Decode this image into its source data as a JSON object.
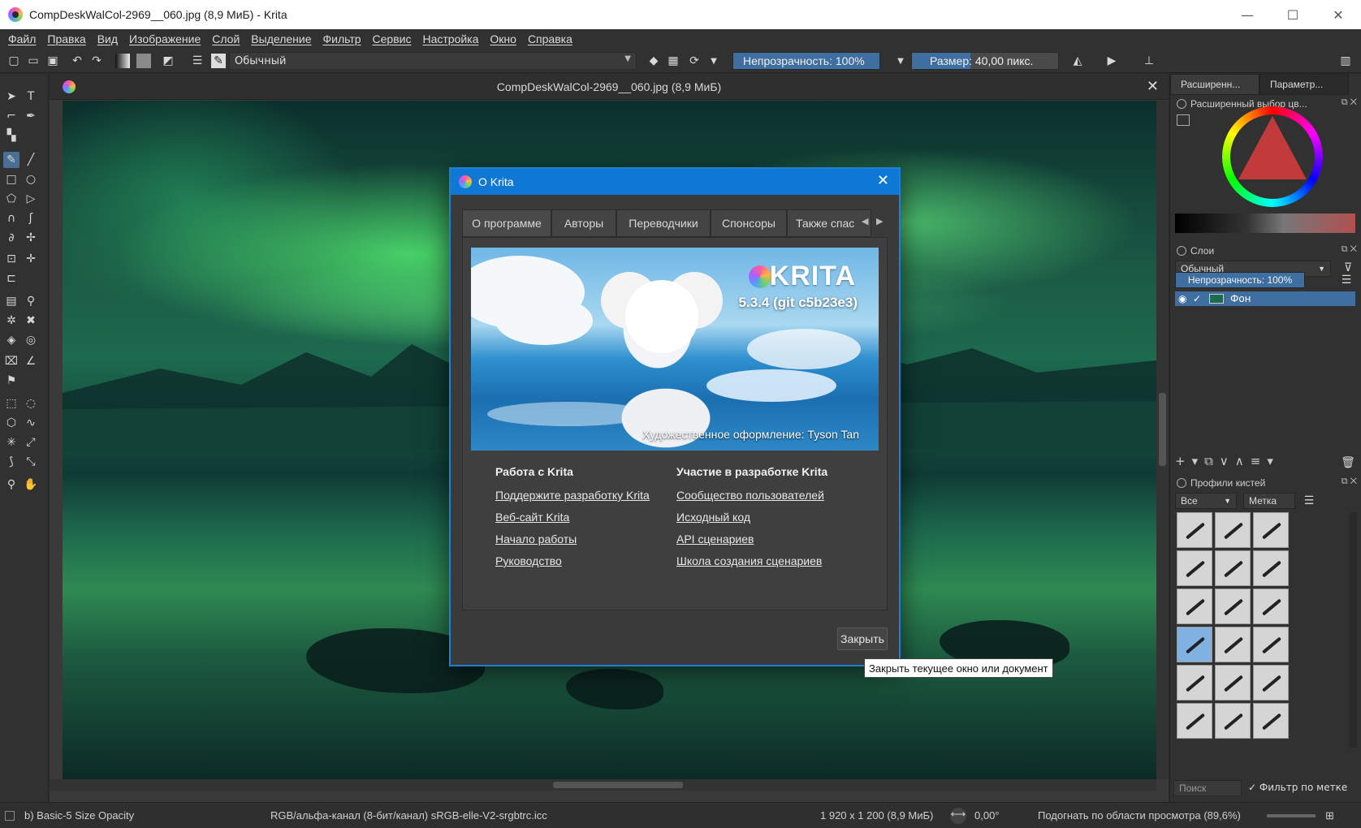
{
  "window": {
    "title": "CompDeskWalCol-2969__060.jpg (8,9 МиБ)  - Krita",
    "minimize": "—",
    "maximize": "☐",
    "close": "✕"
  },
  "menubar": {
    "items": [
      "Файл",
      "Правка",
      "Вид",
      "Изображение",
      "Слой",
      "Выделение",
      "Фильтр",
      "Сервис",
      "Настройка",
      "Окно",
      "Справка"
    ]
  },
  "toolbar": {
    "blend_mode": "Обычный",
    "opacity_label": "Непрозрачность: 100%",
    "opacity_value": 100,
    "size_label": "Размер: 40,00 пикс.",
    "size_value": 40
  },
  "document": {
    "tab_title": "CompDeskWalCol-2969__060.jpg (8,9 МиБ)",
    "close": "✕"
  },
  "dock": {
    "tab_advanced": "Расширенн...",
    "tab_params": "Параметр...",
    "color_header": "Расширенный выбор цв...",
    "layers_header": "Слои",
    "layers_blend": "Обычный",
    "layers_opacity": "Непрозрачность: 100%",
    "layer_name": "Фон",
    "brushes_header": "Профили кистей",
    "brushes_filter": "Все",
    "brushes_tag": "Метка",
    "search_placeholder": "Поиск",
    "filter_by_tag": "Фильтр по метке"
  },
  "statusbar": {
    "brush": "b) Basic-5 Size Opacity",
    "color_space": "RGB/альфа-канал (8-бит/канал)  sRGB-elle-V2-srgbtrc.icc",
    "dimensions": "1 920 x 1 200 (8,9 МиБ)",
    "rotation": "0,00°",
    "zoom": "Подогнать по области просмотра (89,6%)"
  },
  "about": {
    "title": "О Krita",
    "close_icon": "✕",
    "tabs": [
      "О программе",
      "Авторы",
      "Переводчики",
      "Спонсоры",
      "Также спас"
    ],
    "splash": {
      "logo_text": "KRITA",
      "version": "5.3.4 (git c5b23e3)",
      "credit": "Художественное оформление: Tyson Tan"
    },
    "col1": {
      "title": "Работа с Krita",
      "links": [
        "Поддержите разработку Krita",
        "Веб-сайт Krita",
        "Начало работы",
        "Руководство"
      ]
    },
    "col2": {
      "title": "Участие в разработке Krita",
      "links": [
        "Сообщество пользователей",
        "Исходный код",
        "API сценариев",
        "Школа создания сценариев"
      ]
    },
    "close_button": "Закрыть"
  },
  "tooltip": "Закрыть текущее окно или документ",
  "colors": {
    "accent": "#0f78d4",
    "selection": "#3f6ea0",
    "panel": "#313131"
  }
}
